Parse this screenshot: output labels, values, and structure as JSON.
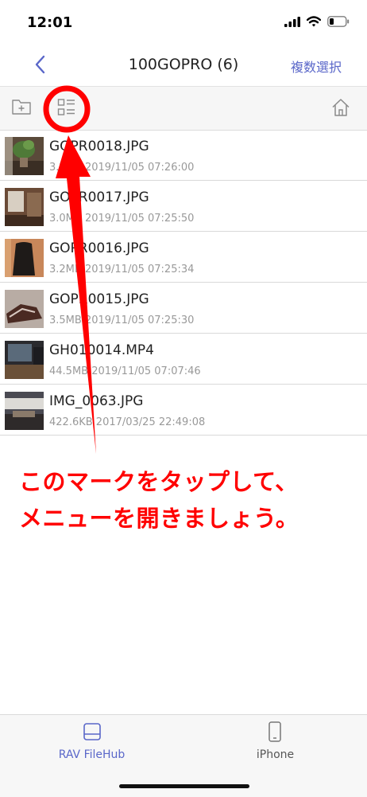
{
  "status": {
    "time": "12:01"
  },
  "nav": {
    "title": "100GOPRO (6)",
    "multi_select": "複数選択"
  },
  "files": [
    {
      "name": "GOPR0018.JPG",
      "meta": "3.2MB 2019/11/05 07:26:00"
    },
    {
      "name": "GOPR0017.JPG",
      "meta": "3.0MB 2019/11/05 07:25:50"
    },
    {
      "name": "GOPR0016.JPG",
      "meta": "3.2MB 2019/11/05 07:25:34"
    },
    {
      "name": "GOPR0015.JPG",
      "meta": "3.5MB 2019/11/05 07:25:30"
    },
    {
      "name": "GH010014.MP4",
      "meta": "44.5MB 2019/11/05 07:07:46"
    },
    {
      "name": "IMG_0063.JPG",
      "meta": "422.6KB 2017/03/25 22:49:08"
    }
  ],
  "tabs": [
    {
      "label": "RAV FileHub",
      "icon": "drive-icon",
      "active": true
    },
    {
      "label": "iPhone",
      "icon": "phone-icon",
      "active": false
    }
  ],
  "annotation": {
    "line1": "このマークをタップして、",
    "line2": "メニューを開きましょう。"
  },
  "colors": {
    "accent": "#5a67c9",
    "annotation": "#ff0000",
    "meta_text": "#999999"
  }
}
